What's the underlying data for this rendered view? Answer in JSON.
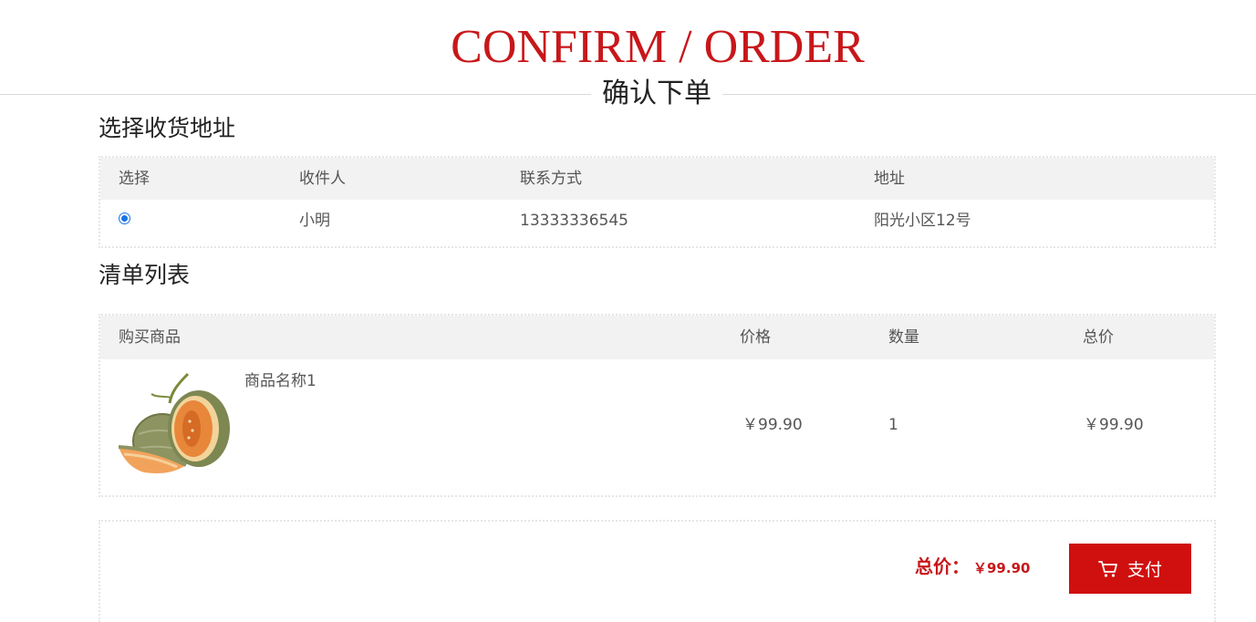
{
  "header": {
    "title_en": "CONFIRM / ORDER",
    "title_cn": "确认下单"
  },
  "address_section": {
    "title": "选择收货地址",
    "columns": [
      "选择",
      "收件人",
      "联系方式",
      "地址"
    ],
    "rows": [
      {
        "selected": true,
        "recipient": "小明",
        "phone": "13333336545",
        "address": "阳光小区12号"
      }
    ]
  },
  "items_section": {
    "title": "清单列表",
    "columns": [
      "购买商品",
      "价格",
      "数量",
      "总价"
    ],
    "rows": [
      {
        "name": "商品名称1",
        "price": "￥99.90",
        "quantity": "1",
        "subtotal": "￥99.90",
        "image": "melon-image"
      }
    ]
  },
  "footer": {
    "total_label": "总价：",
    "total_value": "￥99.90",
    "pay_label": "支付",
    "pay_icon": "cart-icon"
  },
  "colors": {
    "accent": "#c8171a",
    "button": "#d0100f",
    "table_header_bg": "#f2f2f2"
  }
}
